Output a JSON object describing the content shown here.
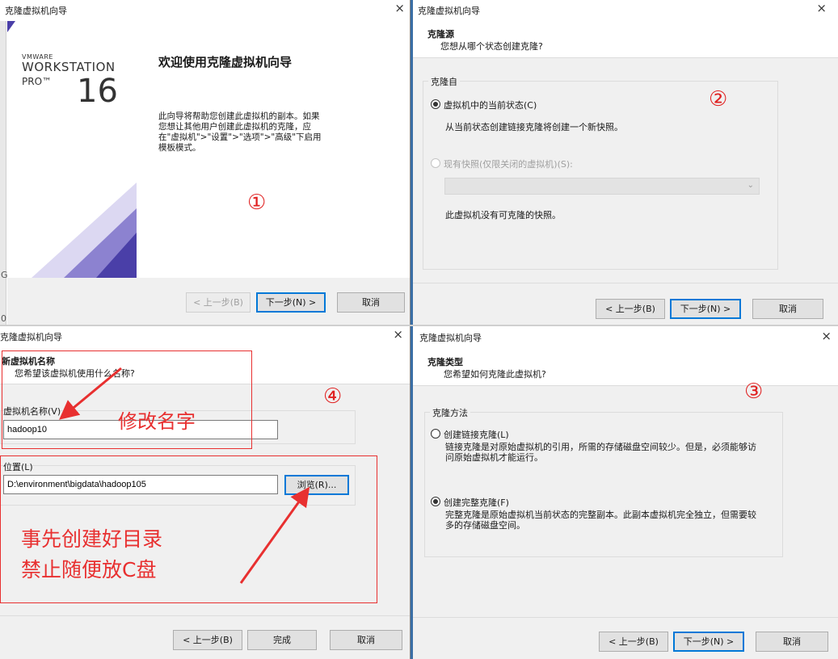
{
  "common": {
    "window_title": "克隆虚拟机向导",
    "close": "×",
    "back": "< 上一步(B)",
    "next": "下一步(N) >",
    "cancel": "取消"
  },
  "panel1": {
    "window_title": "克隆虚拟机向导",
    "brand_vmware": "VMWARE",
    "brand_workstation": "WORKSTATION",
    "brand_pro": "PRO™",
    "brand_version": "16",
    "heading": "欢迎使用克隆虚拟机向导",
    "description": "此向导将帮助您创建此虚拟机的副本。如果您想让其他用户创建此虚拟机的克隆，应在\"虚拟机\">\"设置\">\"选项\">\"高级\"下启用模板模式。",
    "step_marker": "①",
    "edge_text": "0",
    "edge_text2": "G"
  },
  "panel2": {
    "header_title": "克隆源",
    "header_sub": "您想从哪个状态创建克隆?",
    "group_label": "克隆自",
    "option_current": "虚拟机中的当前状态(C)",
    "option_current_desc": "从当前状态创建链接克隆将创建一个新快照。",
    "option_snapshot": "现有快照(仅限关闭的虚拟机)(S):",
    "no_snapshot_text": "此虚拟机没有可克隆的快照。",
    "step_marker": "②"
  },
  "panel3": {
    "window_title": "克隆虚拟机向导",
    "header_title": "新虚拟机名称",
    "header_sub": "您希望该虚拟机使用什么名称?",
    "name_label": "虚拟机名称(V)",
    "name_value": "hadoop10",
    "location_label": "位置(L)",
    "location_value": "D:\\environment\\bigdata\\hadoop105",
    "browse": "浏览(R)...",
    "finish": "完成",
    "annotation_rename": "修改名字",
    "annotation_line1": "事先创建好目录",
    "annotation_line2": "禁止随便放C盘",
    "step_marker": "④"
  },
  "panel4": {
    "header_title": "克隆类型",
    "header_sub": "您希望如何克隆此虚拟机?",
    "group_label": "克隆方法",
    "option_linked": "创建链接克隆(L)",
    "option_linked_desc": "链接克隆是对原始虚拟机的引用，所需的存储磁盘空间较少。但是，必须能够访问原始虚拟机才能运行。",
    "option_full": "创建完整克隆(F)",
    "option_full_desc": "完整克隆是原始虚拟机当前状态的完整副本。此副本虚拟机完全独立，但需要较多的存储磁盘空间。",
    "step_marker": "③"
  },
  "colors": {
    "annotation_red": "#e83030",
    "accent_blue": "#0078d7",
    "vmware_purple": "#5a4fb4"
  }
}
